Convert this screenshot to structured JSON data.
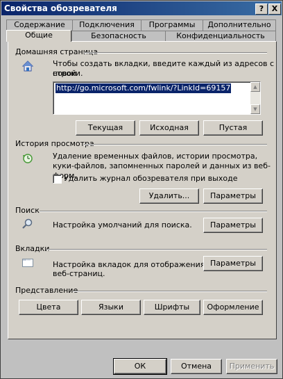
{
  "window": {
    "title": "Свойства обозревателя",
    "help_button": "?",
    "close_button": "X"
  },
  "tabs_row1": [
    "Содержание",
    "Подключения",
    "Программы",
    "Дополнительно"
  ],
  "tabs_row2": [
    "Общие",
    "Безопасность",
    "Конфиденциальность"
  ],
  "homepage": {
    "label": "Домашняя страница",
    "description_line1": "Чтобы создать вкладки, введите каждый из адресов с новой",
    "description_line2": "строки.",
    "url": "http://go.microsoft.com/fwlink/?LinkId=69157",
    "buttons": {
      "current": "Текущая",
      "default": "Исходная",
      "blank": "Пустая"
    }
  },
  "history": {
    "label": "История просмотра",
    "description_line1": "Удаление временных файлов, истории просмотра,",
    "description_line2": "куки-файлов, запомненных паролей и данных из веб-форм.",
    "checkbox_label": "Удалить журнал обозревателя при выходе",
    "checkbox_checked": false,
    "delete_button": "Удалить...",
    "settings_button": "Параметры"
  },
  "search": {
    "label": "Поиск",
    "description": "Настройка умолчаний для поиска.",
    "settings_button": "Параметры"
  },
  "tabs_section": {
    "label": "Вкладки",
    "description_line1": "Настройка вкладок для отображения",
    "description_line2": "веб-страниц.",
    "settings_button": "Параметры"
  },
  "appearance": {
    "label": "Представление",
    "buttons": {
      "colors": "Цвета",
      "languages": "Языки",
      "fonts": "Шрифты",
      "accessibility": "Оформление"
    }
  },
  "footer": {
    "ok": "ОК",
    "cancel": "Отмена",
    "apply": "Применить"
  },
  "colors": {
    "titlebar": "#0a246a",
    "selection": "#0a246a",
    "face": "#d4d0c8"
  }
}
